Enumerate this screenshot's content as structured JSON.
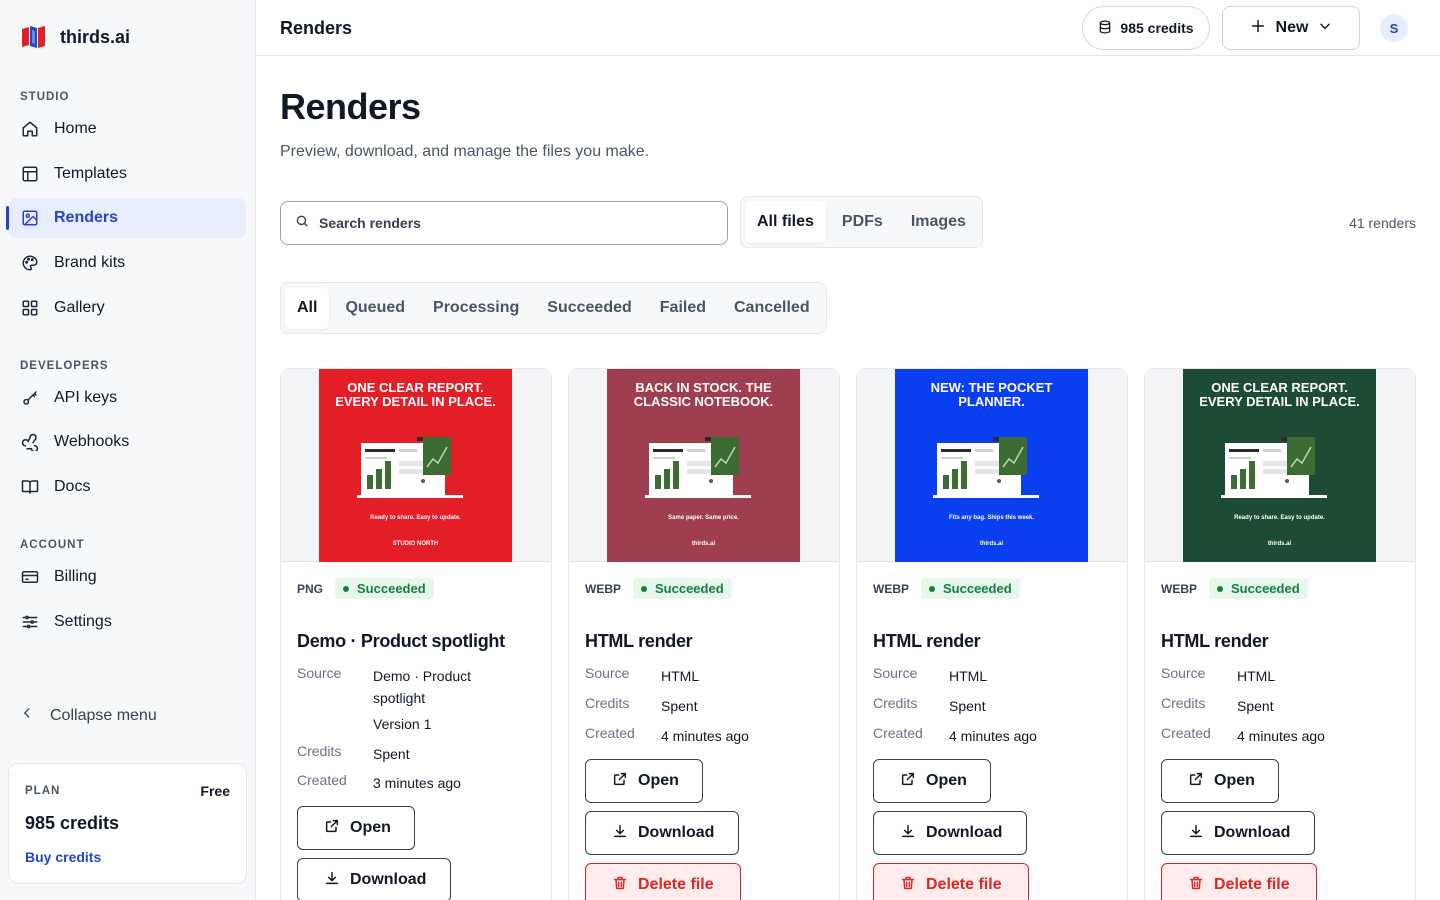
{
  "app": {
    "name": "thirds.ai"
  },
  "sidebar": {
    "sections": [
      {
        "label": "STUDIO"
      },
      {
        "label": "DEVELOPERS"
      },
      {
        "label": "ACCOUNT"
      }
    ],
    "items": [
      {
        "label": "Home",
        "icon": "home-icon"
      },
      {
        "label": "Templates",
        "icon": "layout-icon"
      },
      {
        "label": "Renders",
        "icon": "image-icon",
        "active": true
      },
      {
        "label": "Brand kits",
        "icon": "palette-icon"
      },
      {
        "label": "Gallery",
        "icon": "grid-icon"
      },
      {
        "label": "API keys",
        "icon": "key-icon"
      },
      {
        "label": "Webhooks",
        "icon": "webhook-icon"
      },
      {
        "label": "Docs",
        "icon": "book-icon"
      },
      {
        "label": "Billing",
        "icon": "credit-card-icon"
      },
      {
        "label": "Settings",
        "icon": "sliders-icon"
      }
    ],
    "collapse_label": "Collapse menu",
    "plan": {
      "label": "PLAN",
      "tier": "Free",
      "credits": "985 credits",
      "buy_label": "Buy credits"
    }
  },
  "topbar": {
    "title": "Renders",
    "credits": "985 credits",
    "new_label": "New",
    "avatar_initial": "S"
  },
  "main": {
    "title": "Renders",
    "subtitle": "Preview, download, and manage the files you make.",
    "search_placeholder": "Search renders",
    "type_tabs": [
      {
        "label": "All files",
        "active": true
      },
      {
        "label": "PDFs"
      },
      {
        "label": "Images"
      }
    ],
    "count": "41 renders",
    "status_tabs": [
      {
        "label": "All",
        "active": true
      },
      {
        "label": "Queued"
      },
      {
        "label": "Processing"
      },
      {
        "label": "Succeeded"
      },
      {
        "label": "Failed"
      },
      {
        "label": "Cancelled"
      }
    ]
  },
  "labels": {
    "source": "Source",
    "credits": "Credits",
    "created": "Created",
    "open": "Open",
    "download": "Download",
    "delete": "Delete file"
  },
  "cards": [
    {
      "format": "PNG",
      "status": "Succeeded",
      "title": "Demo · Product spotlight",
      "source_line1": "Demo · Product",
      "source_line2": "spotlight",
      "version": "Version 1",
      "credits": "Spent",
      "created": "3 minutes ago",
      "thumb": {
        "bg": "#e31e26",
        "headline": "ONE CLEAR REPORT. EVERY DETAIL IN PLACE.",
        "tagline": "Ready to share. Easy to update.",
        "footer": "STUDIO NORTH"
      }
    },
    {
      "format": "WEBP",
      "status": "Succeeded",
      "title": "HTML render",
      "source": "HTML",
      "credits": "Spent",
      "created": "4 minutes ago",
      "thumb": {
        "bg": "#9e3e4f",
        "headline": "BACK IN STOCK. THE CLASSIC NOTEBOOK.",
        "tagline": "Same paper. Same price.",
        "footer": "thirds.ai"
      }
    },
    {
      "format": "WEBP",
      "status": "Succeeded",
      "title": "HTML render",
      "source": "HTML",
      "credits": "Spent",
      "created": "4 minutes ago",
      "thumb": {
        "bg": "#0a3ff0",
        "headline": "NEW: THE POCKET PLANNER.",
        "tagline": "Fits any bag. Ships this week.",
        "footer": "thirds.ai"
      }
    },
    {
      "format": "WEBP",
      "status": "Succeeded",
      "title": "HTML render",
      "source": "HTML",
      "credits": "Spent",
      "created": "4 minutes ago",
      "thumb": {
        "bg": "#1e4b33",
        "headline": "ONE CLEAR REPORT. EVERY DETAIL IN PLACE.",
        "tagline": "Ready to share. Easy to update.",
        "footer": "thirds.ai"
      }
    }
  ]
}
